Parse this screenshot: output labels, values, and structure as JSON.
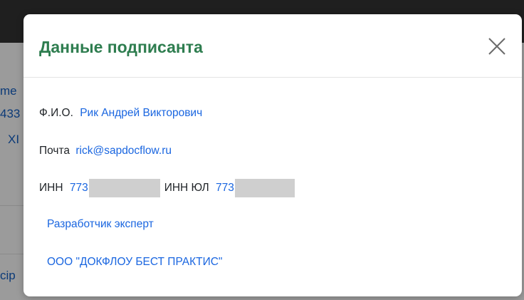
{
  "background": {
    "fragments": [
      "me",
      "433",
      "XI",
      "cip"
    ]
  },
  "dialog": {
    "title": "Данные подписанта",
    "close_label": "Закрыть",
    "fio_label": "Ф.И.О.",
    "fio_value": "Рик Андрей Викторович",
    "email_label": "Почта",
    "email_value": "rick@sapdocflow.ru",
    "inn_label": "ИНН",
    "inn_value": "773",
    "inn_ul_label": "ИНН ЮЛ",
    "inn_ul_value": "773",
    "position": "Разработчик эксперт",
    "company": "ООО \"ДОКФЛОУ БЕСТ ПРАКТИС\""
  },
  "colors": {
    "title": "#2e7d4f",
    "link": "#1a66e0",
    "redaction": "#cfcfcf"
  }
}
